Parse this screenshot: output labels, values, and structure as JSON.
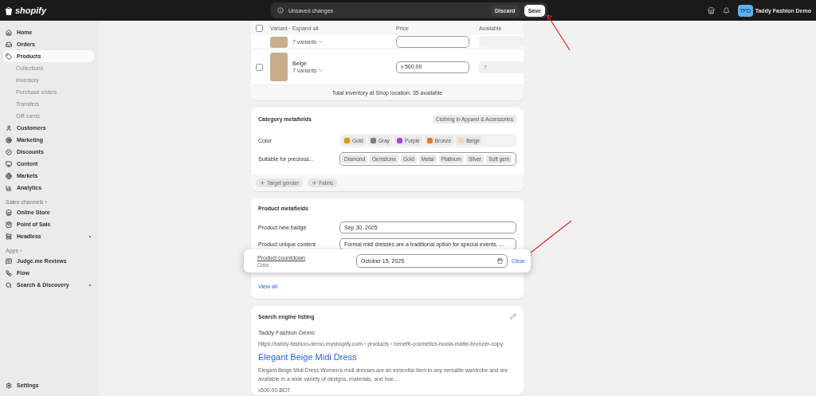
{
  "topbar": {
    "logo": "shopify",
    "unsaved": {
      "message": "Unsaved changes",
      "discard": "Discard",
      "save": "Save"
    },
    "avatar": "TFD",
    "store": "Taddy Fashion Demo"
  },
  "sidebar": {
    "items": [
      {
        "kind": "main",
        "label": "Home",
        "selected": false
      },
      {
        "kind": "main",
        "label": "Orders",
        "selected": false
      },
      {
        "kind": "main",
        "label": "Products",
        "selected": true
      },
      {
        "kind": "sub",
        "label": "Collections",
        "selected": false
      },
      {
        "kind": "sub",
        "label": "Inventory",
        "selected": false
      },
      {
        "kind": "sub",
        "label": "Purchase orders",
        "selected": false
      },
      {
        "kind": "sub",
        "label": "Transfers",
        "selected": false
      },
      {
        "kind": "sub",
        "label": "Gift cards",
        "selected": false
      },
      {
        "kind": "main",
        "label": "Customers",
        "selected": false
      },
      {
        "kind": "main",
        "label": "Marketing",
        "selected": false
      },
      {
        "kind": "main",
        "label": "Discounts",
        "selected": false
      },
      {
        "kind": "main",
        "label": "Content",
        "selected": false
      },
      {
        "kind": "main",
        "label": "Markets",
        "selected": false
      },
      {
        "kind": "main",
        "label": "Analytics",
        "selected": false
      },
      {
        "kind": "section",
        "label": "Sales channels ›"
      },
      {
        "kind": "main",
        "label": "Online Store",
        "selected": false
      },
      {
        "kind": "main",
        "label": "Point of Sale",
        "selected": false
      },
      {
        "kind": "main",
        "label": "Headless",
        "selected": false,
        "pinned": true
      },
      {
        "kind": "section",
        "label": "Apps ›"
      },
      {
        "kind": "main",
        "label": "Judge.me Reviews",
        "selected": false
      },
      {
        "kind": "main",
        "label": "Flow",
        "selected": false
      },
      {
        "kind": "main",
        "label": "Search & Discovery",
        "selected": false,
        "pinned": true
      }
    ],
    "settings": "Settings"
  },
  "variants": {
    "all_checked": false,
    "columns": [
      "Variant · Expand all",
      "Price",
      "Available"
    ],
    "rows": [
      {
        "name": "",
        "count": "7 variants",
        "price": "",
        "available": ""
      },
      {
        "checked": false,
        "name": "Beige",
        "count": "7 variants",
        "price": "৳ 500.00",
        "available": "7"
      }
    ],
    "footer": "Total inventory at Shop location: 35 available"
  },
  "category": {
    "title": "Category metafields",
    "badge": "Clothing in Apparel & Accessories",
    "color_label": "Color",
    "colors": [
      {
        "label": "Gold",
        "color": "#d89e0f"
      },
      {
        "label": "Gray",
        "color": "#7b7b7b"
      },
      {
        "label": "Purple",
        "color": "#a545d6"
      },
      {
        "label": "Bronze",
        "color": "#d27f2e"
      },
      {
        "label": "Beige",
        "color": "#efd9ae"
      }
    ],
    "precious_label": "Suitable for precious...",
    "precious": [
      "Diamond",
      "Gemstone",
      "Gold",
      "Metal",
      "Platinum",
      "Silver",
      "Soft gem"
    ],
    "add": [
      "Target gender",
      "Fabric"
    ]
  },
  "product_metafields": {
    "title": "Product metafields",
    "fields": [
      {
        "label": "Product new badge",
        "value": "Sep 30, 2025"
      },
      {
        "label": "Product unique content",
        "value": "Formal midi dresses are a traditional option for special events. ..."
      }
    ],
    "popup": {
      "label": "Product countdown",
      "type": "Date",
      "value": "October 15, 2025",
      "clear": "Clear"
    },
    "view_all": "View all"
  },
  "seo": {
    "title": "Search engine listing",
    "store": "Taddy Fashion Demo",
    "url": "https://taddy-fashion-demo.myshopify.com › products › benefit-cosmetics-hoola-matte-bronzer-copy",
    "page_title": "Elegant Beige Midi Dress",
    "description": "Elegant Beige Midi Dress Women's midi dresses are an essential item in any versatile wardrobe and are available in a wide variety of designs, materials, and hue...",
    "price": "৳500.00 BDT"
  }
}
